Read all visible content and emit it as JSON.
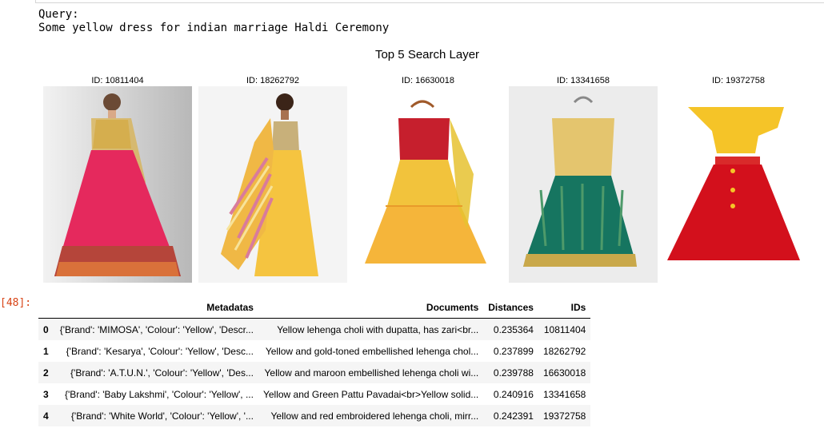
{
  "output": {
    "query_label": "Query:",
    "query_text": "Some yellow dress for indian marriage Haldi Ceremony",
    "prompt_label": "[48]:"
  },
  "figure": {
    "title": "Top 5 Search Layer",
    "items": [
      {
        "caption": "ID: 10811404"
      },
      {
        "caption": "ID: 18262792"
      },
      {
        "caption": "ID: 16630018"
      },
      {
        "caption": "ID: 13341658"
      },
      {
        "caption": "ID: 19372758"
      }
    ]
  },
  "table": {
    "columns": [
      "",
      "Metadatas",
      "Documents",
      "Distances",
      "IDs"
    ],
    "rows": [
      {
        "index": "0",
        "metadatas": "{'Brand': 'MIMOSA', 'Colour': 'Yellow', 'Descr...",
        "documents": "Yellow lehenga choli with dupatta, has zari<br...",
        "distances": "0.235364",
        "ids": "10811404"
      },
      {
        "index": "1",
        "metadatas": "{'Brand': 'Kesarya', 'Colour': 'Yellow', 'Desc...",
        "documents": "Yellow and gold-toned embellished lehenga chol...",
        "distances": "0.237899",
        "ids": "18262792"
      },
      {
        "index": "2",
        "metadatas": "{'Brand': 'A.T.U.N.', 'Colour': 'Yellow', 'Des...",
        "documents": "Yellow and maroon embellished lehenga choli wi...",
        "distances": "0.239788",
        "ids": "16630018"
      },
      {
        "index": "3",
        "metadatas": "{'Brand': 'Baby Lakshmi', 'Colour': 'Yellow', ...",
        "documents": "Yellow and Green Pattu Pavadai<br>Yellow solid...",
        "distances": "0.240916",
        "ids": "13341658"
      },
      {
        "index": "4",
        "metadatas": "{'Brand': 'White World', 'Colour': 'Yellow', '...",
        "documents": "Yellow and red embroidered lehenga choli, mirr...",
        "distances": "0.242391",
        "ids": "19372758"
      }
    ]
  }
}
